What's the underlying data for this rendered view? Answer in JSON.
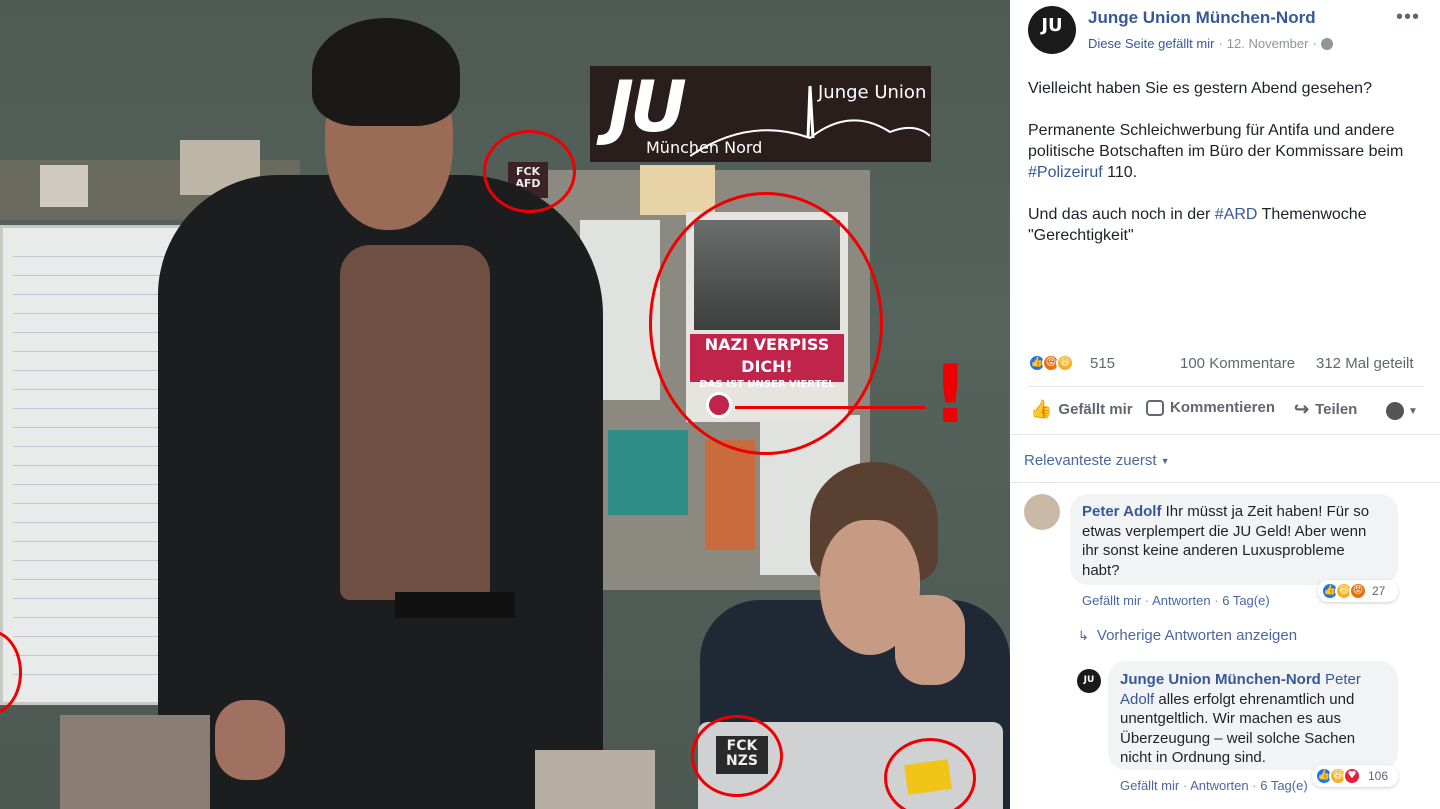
{
  "photo": {
    "logo": {
      "ju": "JU",
      "city": "München Nord",
      "name": "Junge Union"
    },
    "poster": {
      "line1": "NAZI VERPISS DICH!",
      "line2": "DAS IST UNSER VIERTEL"
    },
    "sticker_top": "FCK AFD",
    "sticker_laptop": "FCK NZS",
    "exclamation": "!"
  },
  "post": {
    "page_name": "Junge Union München-Nord",
    "avatar_text": "JU",
    "liked_label": "Diese Seite gefällt mir",
    "date": "12. November",
    "text_line1": "Vielleicht haben Sie es gestern Abend gesehen?",
    "text_p2_a": "Permanente Schleichwerbung für Antifa und andere politische Botschaften im Büro der Kommissare beim ",
    "text_p2_tag": "#Polizeiruf",
    "text_p2_b": " 110.",
    "text_p3_a": "Und das auch noch in der ",
    "text_p3_tag": "#ARD",
    "text_p3_b": " Themenwoche \"Gerechtigkeit\"",
    "reactions_count": "515",
    "comments_count": "100 Kommentare",
    "shares_count": "312 Mal geteilt",
    "like_label": "Gefällt mir",
    "comment_label": "Kommentieren",
    "share_label": "Teilen",
    "sort_label": "Relevanteste zuerst"
  },
  "comments": [
    {
      "author": "Peter Adolf",
      "text": "Ihr müsst ja Zeit haben! Für so etwas verplempert die JU Geld! Aber wenn ihr sonst keine anderen Luxusprobleme habt?",
      "like": "Gefällt mir",
      "reply": "Antworten",
      "time": "6 Tag(e)",
      "reactions": "27"
    }
  ],
  "previous_replies": "Vorherige Antworten anzeigen",
  "reply": {
    "author": "Junge Union München-Nord",
    "mention": "Peter Adolf",
    "text": " alles erfolgt ehrenamtlich und unentgeltlich. Wir machen es aus Überzeugung – weil solche Sachen nicht in Ordnung sind.",
    "like": "Gefällt mir",
    "reply": "Antworten",
    "time": "6 Tag(e)",
    "reactions": "106"
  },
  "colors": {
    "link": "#365899",
    "meta": "#90949c",
    "annotation": "#e00000",
    "like_blue": "#1877f2"
  }
}
